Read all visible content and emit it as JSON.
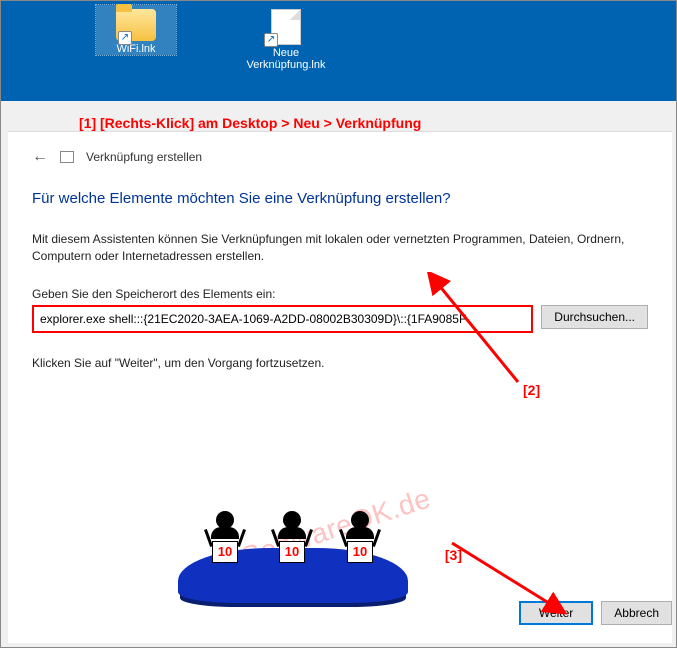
{
  "desktop": {
    "icons": [
      {
        "label": "WiFi.lnk",
        "type": "folder",
        "selected": true
      },
      {
        "label": "Neue Verknüpfung.lnk",
        "type": "document",
        "selected": false
      }
    ]
  },
  "annotations": {
    "step1": "[1]  [Rechts-Klick] am Desktop > Neu > Verknüpfung",
    "step2": "[2]",
    "step3": "[3]"
  },
  "dialog": {
    "crumb": "Verknüpfung erstellen",
    "title": "Für welche Elemente möchten Sie eine Verknüpfung erstellen?",
    "intro": "Mit diesem Assistenten können Sie Verknüpfungen mit lokalen oder vernetzten Programmen, Dateien, Ordnern, Computern oder Internetadressen erstellen.",
    "location_label": "Geben Sie den Speicherort des Elements ein:",
    "location_value": "explorer.exe shell:::{21EC2020-3AEA-1069-A2DD-08002B30309D}\\::{1FA9085F",
    "browse": "Durchsuchen...",
    "continue_hint": "Klicken Sie auf \"Weiter\", um den Vorgang fortzusetzen.",
    "next": "Weiter",
    "cancel": "Abbrech"
  },
  "watermark": "SoftwareOK.de",
  "cartoon_score": "10"
}
